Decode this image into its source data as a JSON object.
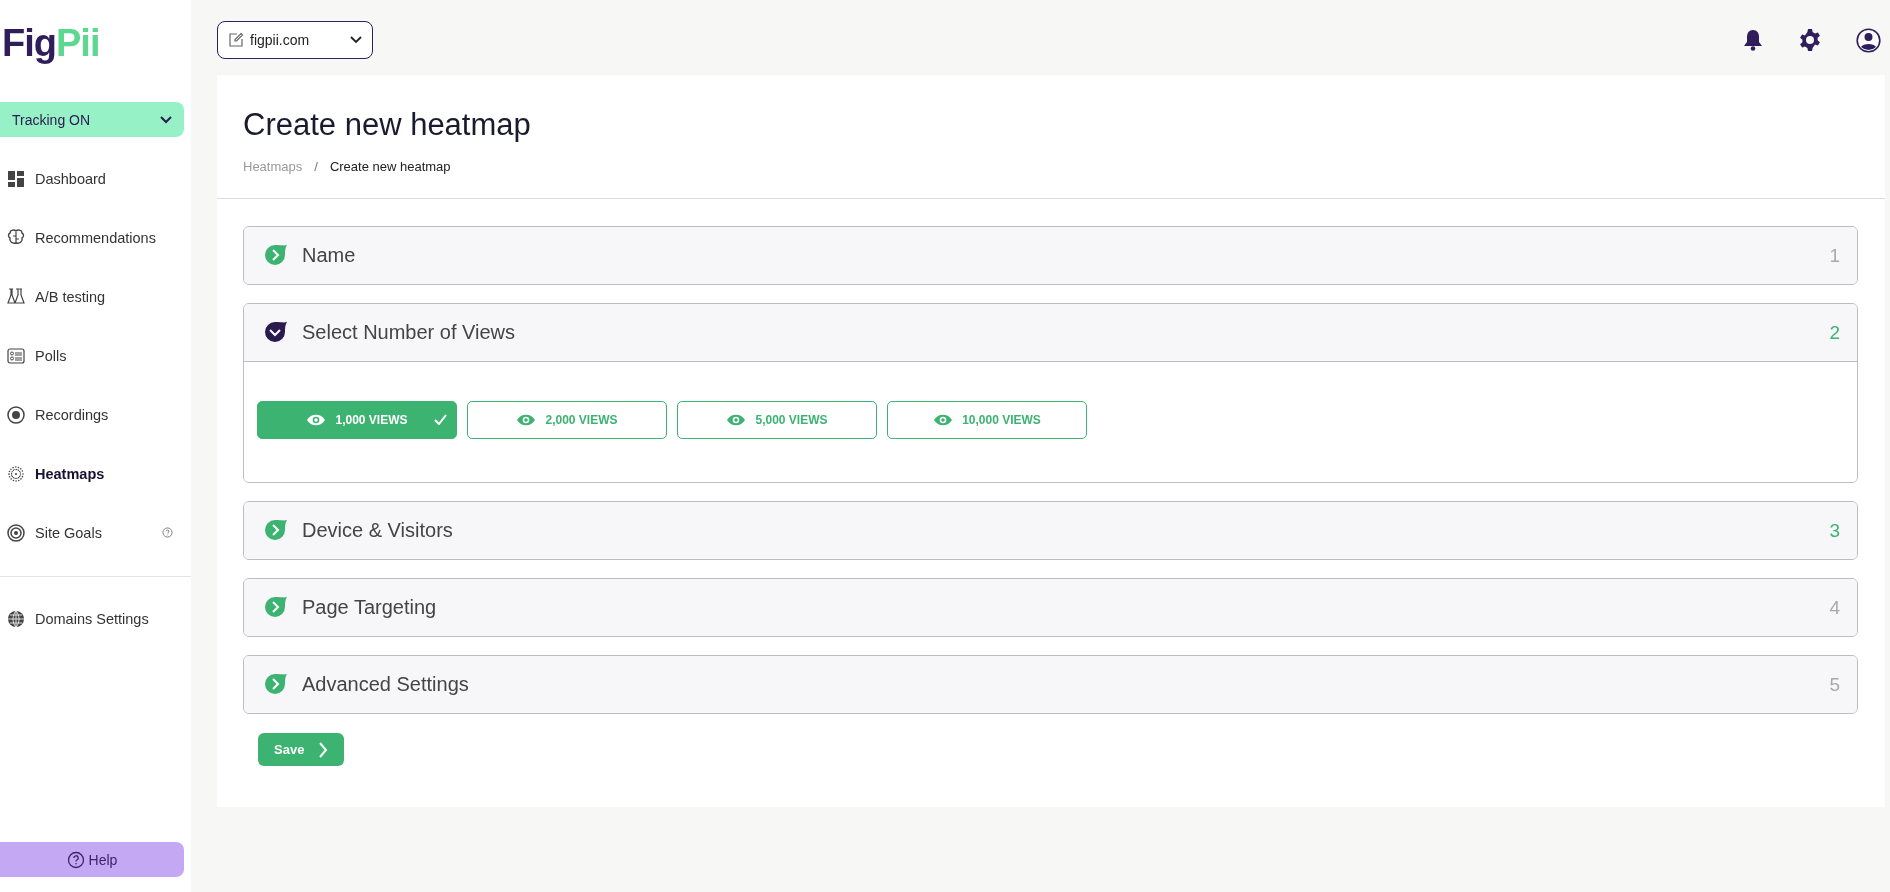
{
  "logo": [
    "Fig",
    "Pii"
  ],
  "tracking": {
    "label": "Tracking ON"
  },
  "sidebar": {
    "items": [
      {
        "label": "Dashboard",
        "selected": false,
        "info": false
      },
      {
        "label": "Recommendations",
        "selected": false,
        "info": false
      },
      {
        "label": "A/B testing",
        "selected": false,
        "info": false
      },
      {
        "label": "Polls",
        "selected": false,
        "info": false
      },
      {
        "label": "Recordings",
        "selected": false,
        "info": false
      },
      {
        "label": "Heatmaps",
        "selected": true,
        "info": false
      },
      {
        "label": "Site Goals",
        "selected": false,
        "info": true
      }
    ],
    "bottom_items": [
      {
        "label": "Domains Settings",
        "selected": false
      }
    ],
    "help": "Help"
  },
  "domain_select": {
    "value": "figpii.com"
  },
  "page": {
    "title": "Create new heatmap",
    "breadcrumb": [
      "Heatmaps",
      "/",
      "Create new heatmap"
    ]
  },
  "steps": [
    {
      "title": "Name",
      "number": "1",
      "expanded": false,
      "done": false
    },
    {
      "title": "Select Number of Views",
      "number": "2",
      "expanded": true,
      "done": true
    },
    {
      "title": "Device & Visitors",
      "number": "3",
      "expanded": false,
      "done": true
    },
    {
      "title": "Page Targeting",
      "number": "4",
      "expanded": false,
      "done": false
    },
    {
      "title": "Advanced Settings",
      "number": "5",
      "expanded": false,
      "done": false
    }
  ],
  "view_options": [
    {
      "label": "1,000 VIEWS",
      "selected": true
    },
    {
      "label": "2,000 VIEWS",
      "selected": false
    },
    {
      "label": "5,000 VIEWS",
      "selected": false
    },
    {
      "label": "10,000 VIEWS",
      "selected": false
    }
  ],
  "save": "Save"
}
